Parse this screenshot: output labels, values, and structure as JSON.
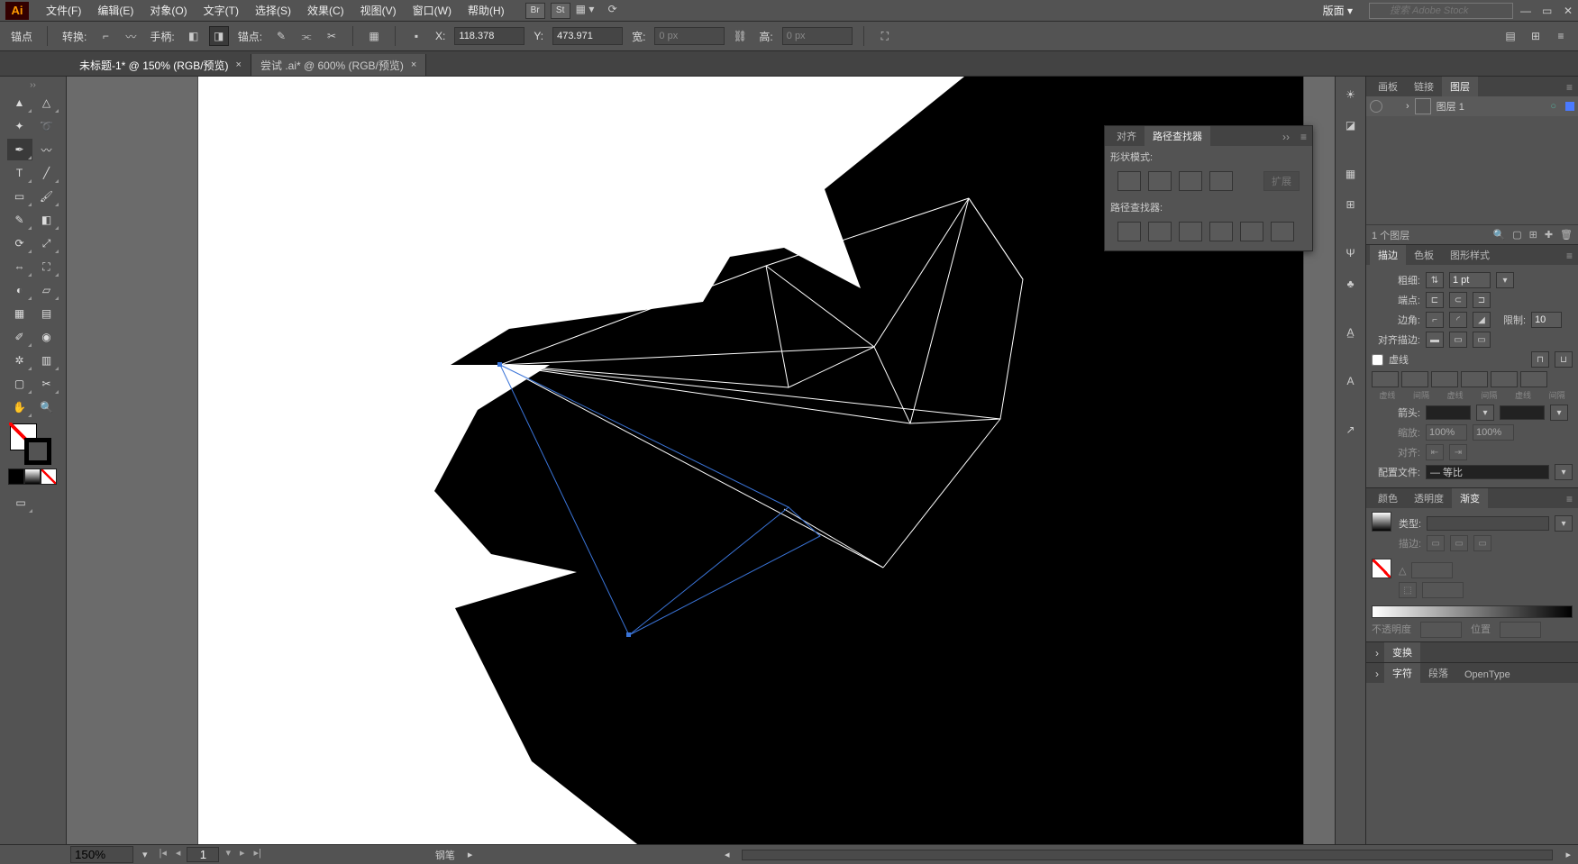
{
  "app": {
    "logo": "Ai"
  },
  "menu": {
    "items": [
      "文件(F)",
      "编辑(E)",
      "对象(O)",
      "文字(T)",
      "选择(S)",
      "效果(C)",
      "视图(V)",
      "窗口(W)",
      "帮助(H)"
    ],
    "workspace_label": "版面 ▾",
    "search_placeholder": "搜索 Adobe Stock"
  },
  "options": {
    "anchor_label": "锚点",
    "convert_label": "转换:",
    "handle_label": "手柄:",
    "anchors_label": "锚点:",
    "x_label": "X:",
    "y_label": "Y:",
    "w_label": "宽:",
    "h_label": "高:",
    "x_value": "118.378",
    "y_value": "473.971",
    "w_value": "0 px",
    "h_value": "0 px"
  },
  "tabs": [
    {
      "label": "未标题-1* @ 150% (RGB/预览)",
      "active": true
    },
    {
      "label": "尝试 .ai* @ 600% (RGB/预览)",
      "active": false
    }
  ],
  "toolbox_icons": [
    "selection",
    "direct-selection",
    "magic-wand",
    "lasso",
    "pen",
    "curvature",
    "type",
    "line",
    "rectangle",
    "paintbrush",
    "shaper",
    "eraser",
    "rotate",
    "scale",
    "width",
    "free-transform",
    "shape-builder",
    "perspective",
    "mesh",
    "gradient",
    "eyedropper",
    "blend",
    "symbol-sprayer",
    "column-graph",
    "artboard",
    "slice",
    "hand",
    "zoom"
  ],
  "right_strip": [
    "color-guide",
    "swatches",
    "brushes",
    "symbols",
    "stroke",
    "align",
    "transform",
    "appearance",
    "graphic-styles",
    "layers",
    "artboards",
    "char"
  ],
  "layers_panel": {
    "tabs": [
      "画板",
      "链接",
      "图层"
    ],
    "active_tab": 2,
    "row_label": "图层 1",
    "footer_count": "1 个图层"
  },
  "stroke_panel": {
    "tabs": [
      "描边",
      "色板",
      "图形样式"
    ],
    "active_tab": 0,
    "weight_label": "粗细:",
    "weight_value": "1 pt",
    "cap_label": "端点:",
    "corner_label": "边角:",
    "limit_label": "限制:",
    "limit_value": "10",
    "align_label": "对齐描边:",
    "dashed_label": "虚线",
    "dash_labels": [
      "虚线",
      "间隔",
      "虚线",
      "间隔",
      "虚线",
      "间隔"
    ],
    "arrow_label": "箭头:",
    "scale_label": "缩放:",
    "scale_a": "100%",
    "scale_b": "100%",
    "align2_label": "对齐:",
    "profile_label": "配置文件:",
    "profile_value": "— 等比"
  },
  "gradient_panel": {
    "tabs": [
      "颜色",
      "透明度",
      "渐变"
    ],
    "active_tab": 2,
    "type_label": "类型:",
    "stroke_label": "描边:",
    "angle_label": "△",
    "opacity_label": "不透明度",
    "location_label": "位置"
  },
  "transform_panel": {
    "tabs": [
      "变换"
    ],
    "more_tabs": [
      "字符",
      "段落",
      "OpenType"
    ]
  },
  "pathfinder": {
    "tabs": [
      "对齐",
      "路径查找器"
    ],
    "active_tab": 1,
    "shapemode_label": "形状模式:",
    "pathfinder_label": "路径查找器:",
    "expand_label": "扩展"
  },
  "status": {
    "zoom": "150%",
    "artboard_num": "1",
    "tool_name": "钢笔"
  }
}
